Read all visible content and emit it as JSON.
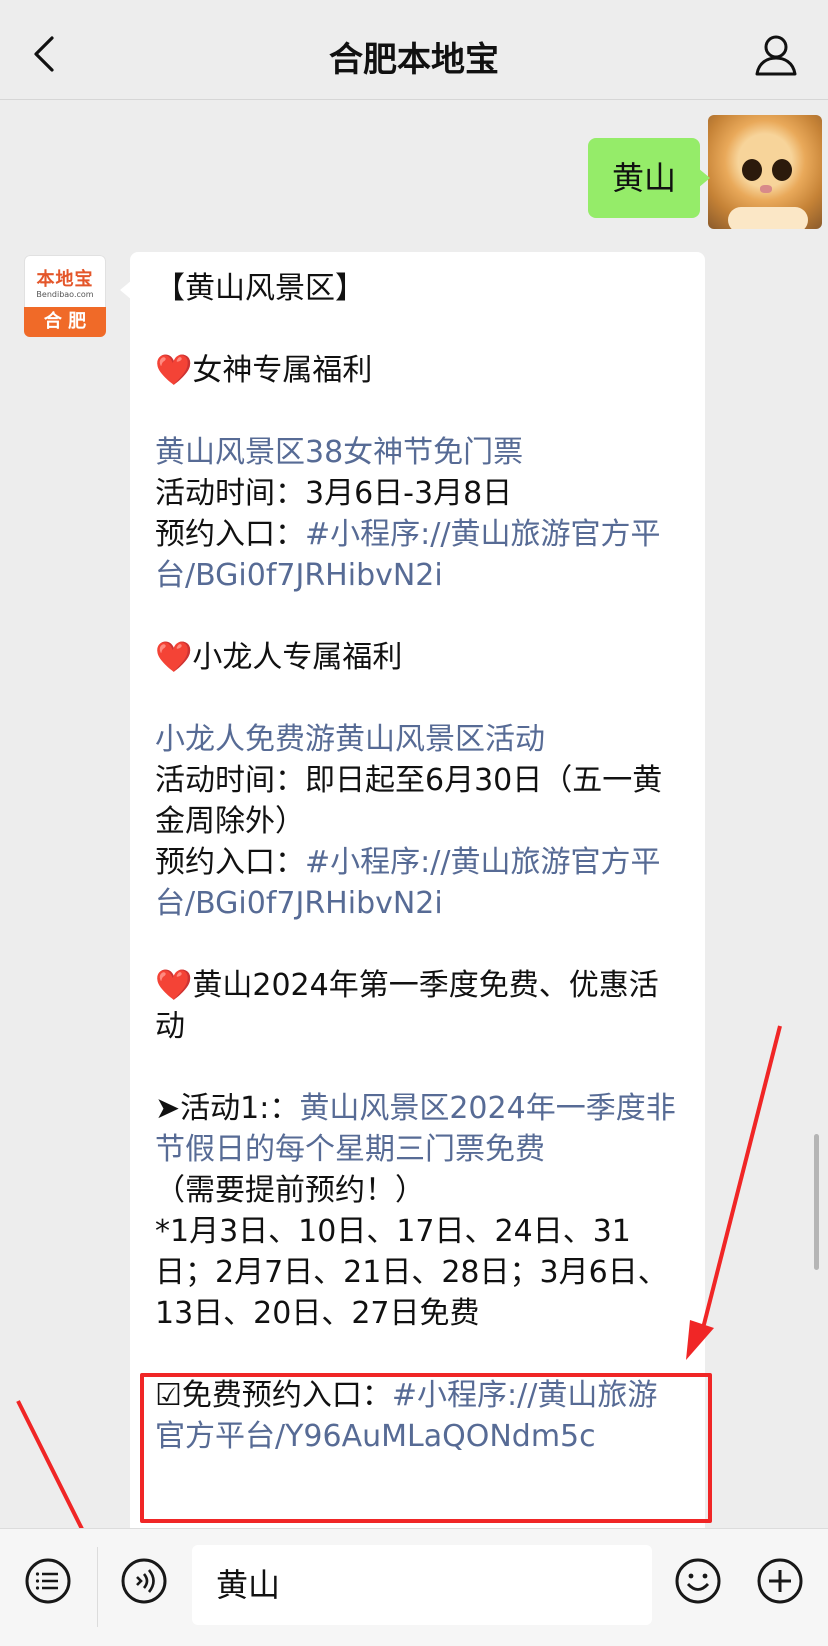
{
  "header": {
    "title": "合肥本地宝",
    "back_icon": "chevron-left-icon",
    "profile_icon": "person-icon"
  },
  "chat": {
    "sent": {
      "text": "黄山"
    },
    "bot_avatar": {
      "brand": "本地宝",
      "brand_sub": "Bendibao.com",
      "city": "合 肥"
    },
    "reply": {
      "heading": "【黄山风景区】",
      "section1": {
        "title": "女神专属福利",
        "link": "黄山风景区38女神节免门票",
        "time": "活动时间：3月6日-3月8日",
        "entry_label": "预约入口：",
        "entry_link": "#小程序://黄山旅游官方平台/BGi0f7JRHibvN2i"
      },
      "section2": {
        "title": "小龙人专属福利",
        "link": "小龙人免费游黄山风景区活动",
        "time": "活动时间：即日起至6月30日（五一黄金周除外）",
        "entry_label": "预约入口：",
        "entry_link": "#小程序://黄山旅游官方平台/BGi0f7JRHibvN2i"
      },
      "section3": {
        "title": "黄山2024年第一季度免费、优惠活动",
        "activity_prefix": "➤活动1:：",
        "activity_link": "黄山风景区2024年一季度非节假日的每个星期三门票免费",
        "note": "（需要提前预约！）",
        "dates": "*1月3日、10日、17日、24日、31日；2月7日、21日、28日；3月6日、13日、20日、27日免费",
        "free_entry_label": "☑免费预约入口：",
        "free_entry_link": "#小程序://黄山旅游官方平台/Y96AuMLaQONdm5c"
      }
    }
  },
  "input_bar": {
    "value": "黄山",
    "menu_icon": "list-menu-icon",
    "voice_icon": "voice-icon",
    "emoji_icon": "emoji-icon",
    "plus_icon": "plus-icon"
  },
  "colors": {
    "link": "#576b95",
    "sent_bubble": "#95ec69",
    "highlight": "#f02626",
    "annotation_arrow": "#f02626"
  }
}
